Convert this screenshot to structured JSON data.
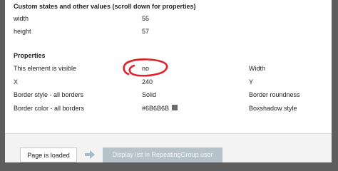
{
  "custom_states": {
    "title": "Custom states and other values (scroll down for properties)",
    "rows": [
      {
        "label": "width",
        "value": "55"
      },
      {
        "label": "height",
        "value": "57"
      }
    ]
  },
  "properties": {
    "title": "Properties",
    "rows": [
      {
        "label": "This element is visible",
        "value": "no",
        "right_label": "Width"
      },
      {
        "label": "X",
        "value": "240",
        "right_label": "Y"
      },
      {
        "label": "Border style - all borders",
        "value": "Solid",
        "right_label": "Border roundness"
      },
      {
        "label": "Border color - all borders",
        "value": "#6B6B6B",
        "right_label": "Boxshadow style"
      }
    ],
    "border_color_swatch": "#6B6B6B",
    "annotation_color": "#e0202a"
  },
  "footer": {
    "step1_label": "Page is loaded",
    "step2_label": "Display list in RepeatingGroup user"
  }
}
